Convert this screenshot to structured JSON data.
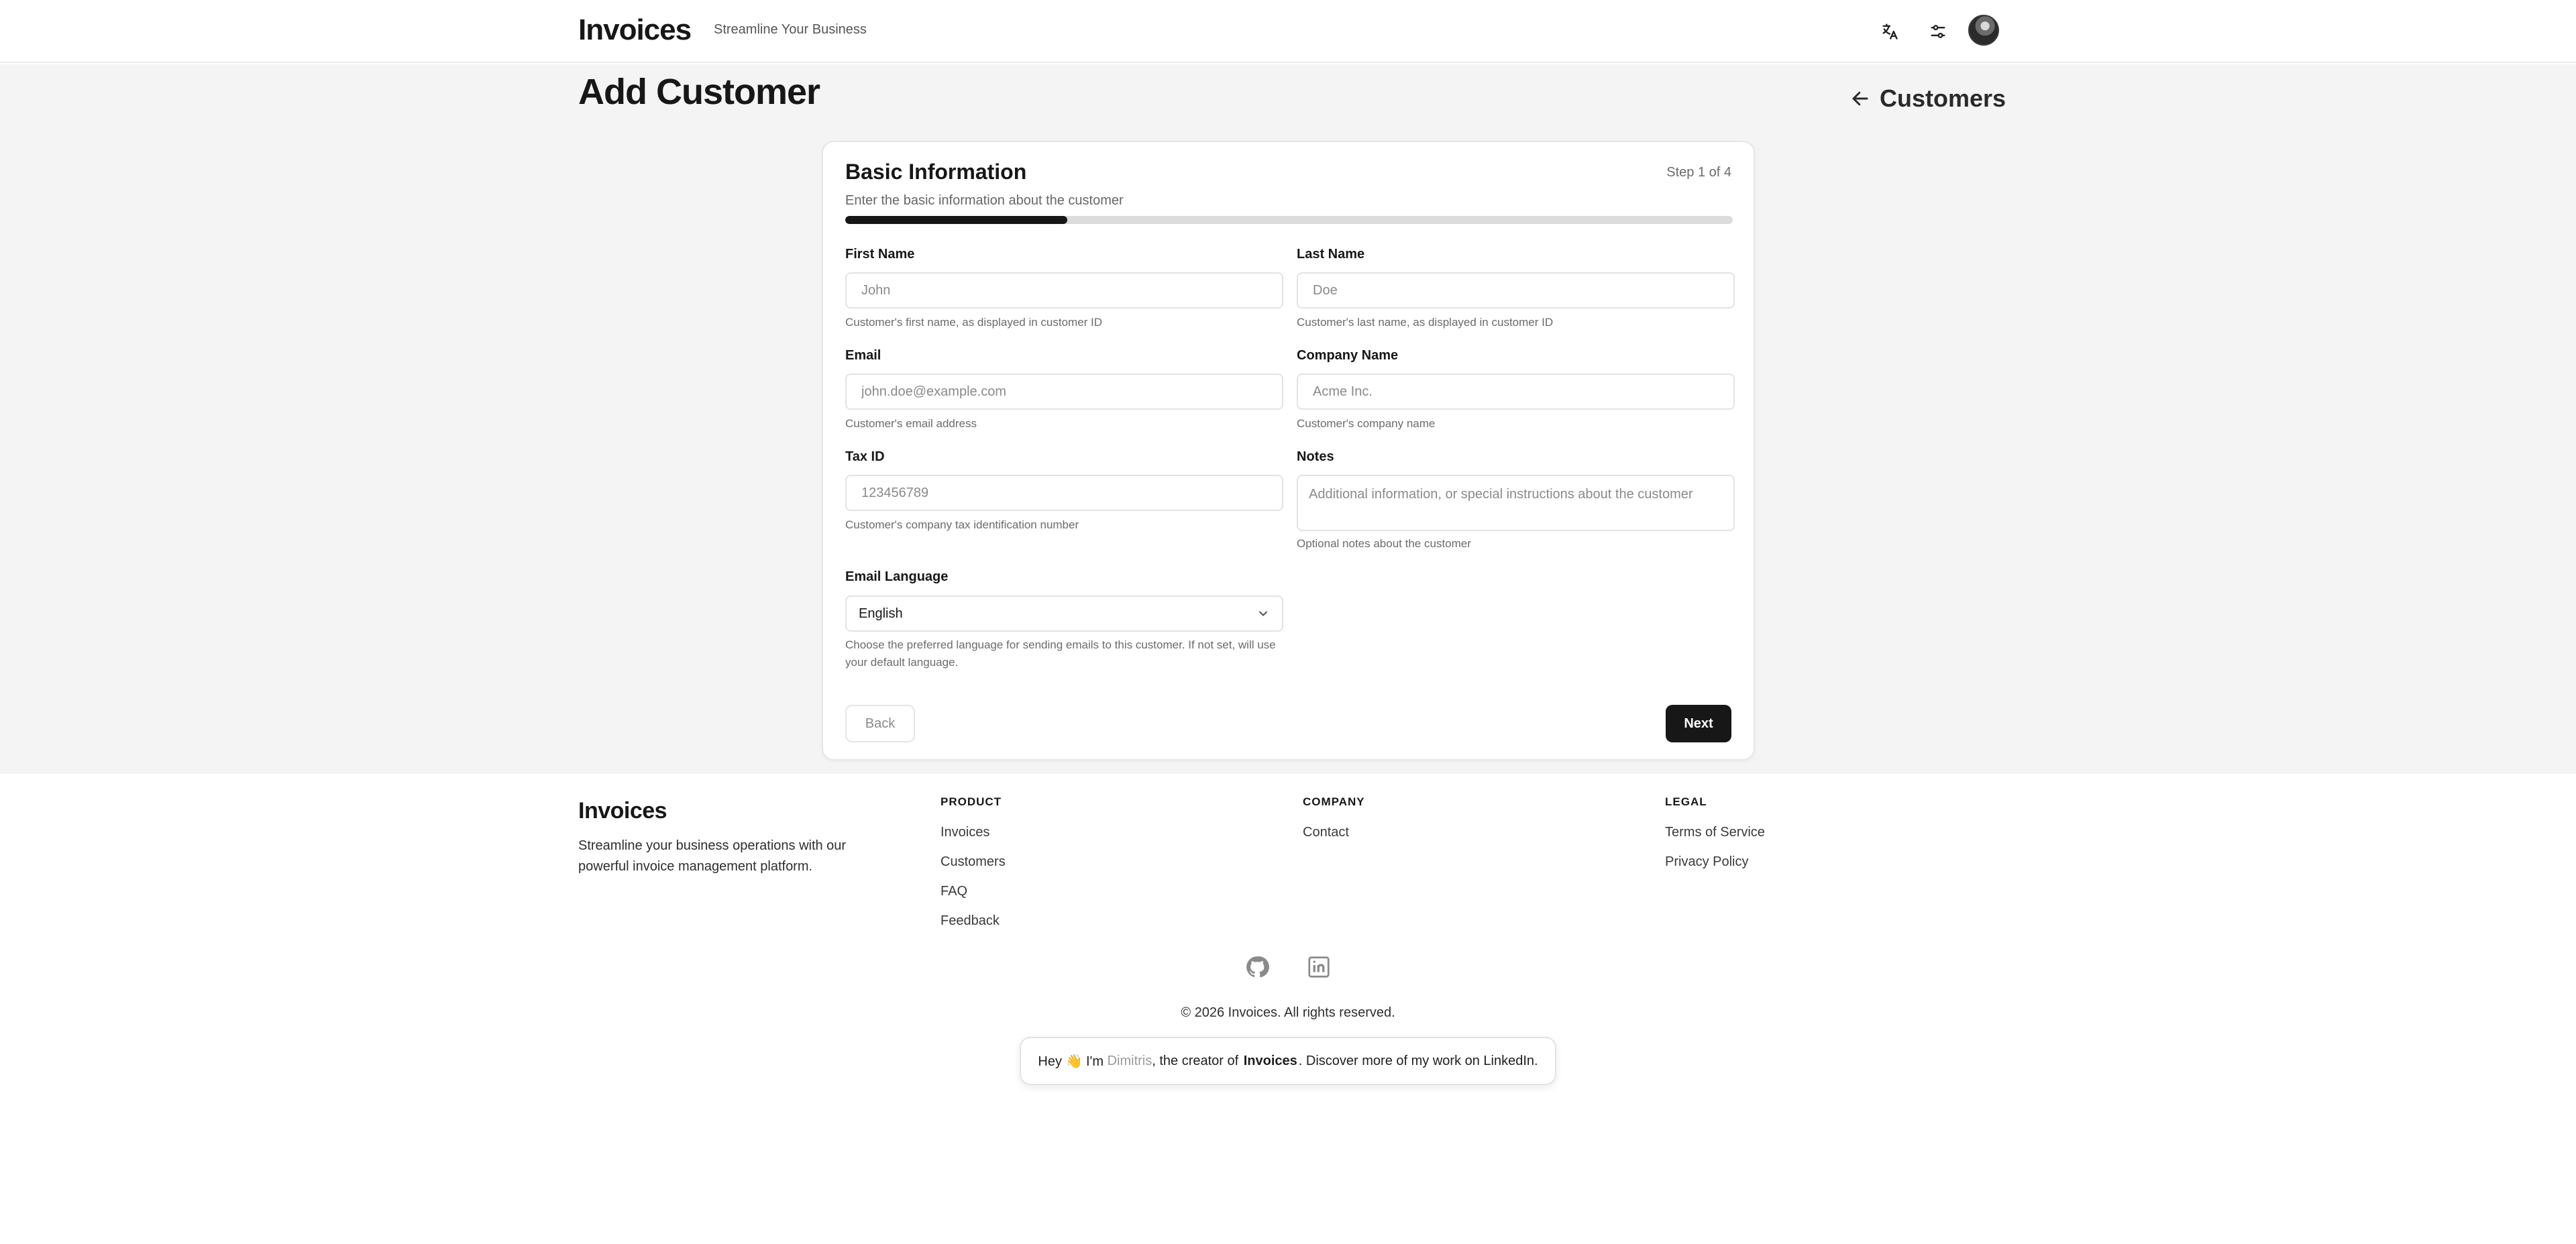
{
  "header": {
    "brand": "Invoices",
    "tagline": "Streamline Your Business"
  },
  "page": {
    "title": "Add Customer",
    "back_label": "Customers"
  },
  "form": {
    "title": "Basic Information",
    "step": "Step 1 of 4",
    "description": "Enter the basic information about the customer",
    "progress": 0.25,
    "fields": {
      "first_name": {
        "label": "First Name",
        "placeholder": "John",
        "help": "Customer's first name, as displayed in customer ID"
      },
      "last_name": {
        "label": "Last Name",
        "placeholder": "Doe",
        "help": "Customer's last name, as displayed in customer ID"
      },
      "email": {
        "label": "Email",
        "placeholder": "john.doe@example.com",
        "help": "Customer's email address"
      },
      "company": {
        "label": "Company Name",
        "placeholder": "Acme Inc.",
        "help": "Customer's company name"
      },
      "tax_id": {
        "label": "Tax ID",
        "placeholder": "123456789",
        "help": "Customer's company tax identification number"
      },
      "notes": {
        "label": "Notes",
        "placeholder": "Additional information, or special instructions about the customer",
        "help": "Optional notes about the customer"
      },
      "email_language": {
        "label": "Email Language",
        "value": "English",
        "help": "Choose the preferred language for sending emails to this customer. If not set, will use your default language."
      }
    },
    "back_button": "Back",
    "next_button": "Next"
  },
  "footer": {
    "brand": "Invoices",
    "description": "Streamline your business operations with our powerful invoice management platform.",
    "columns": [
      {
        "heading": "PRODUCT",
        "links": [
          "Invoices",
          "Customers",
          "FAQ",
          "Feedback"
        ]
      },
      {
        "heading": "COMPANY",
        "links": [
          "Contact"
        ]
      },
      {
        "heading": "LEGAL",
        "links": [
          "Terms of Service",
          "Privacy Policy"
        ]
      }
    ],
    "copyright": "© 2026 Invoices. All rights reserved.",
    "creator": {
      "prefix": "Hey 👋 I'm ",
      "name": "Dimitris",
      "middle": ", the creator of ",
      "product": "Invoices",
      "suffix": ". Discover more of my work on LinkedIn."
    }
  },
  "icons": {
    "translate": "translate-icon",
    "settings": "sliders-icon",
    "back": "arrow-left-icon",
    "select": "chevron-down-icon",
    "github": "github-icon",
    "linkedin": "linkedin-icon"
  },
  "colors": {
    "primary": "#171717",
    "page_bg": "#f4f4f4",
    "progress_track": "#dcdcdc"
  }
}
